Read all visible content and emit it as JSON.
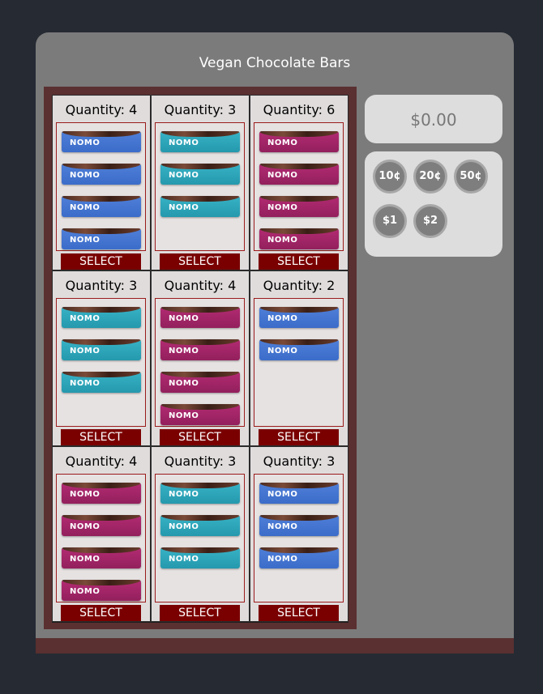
{
  "title": "Vegan Chocolate Bars",
  "display": {
    "amount": "$0.00"
  },
  "coins": [
    "10¢",
    "20¢",
    "50¢",
    "$1",
    "$2"
  ],
  "bar_logo": "NOMO",
  "select_label": "SELECT",
  "quantity_prefix": "Quantity: ",
  "colors": {
    "blue": "#4f7fd8",
    "teal": "#38b2c6",
    "pink": "#b32b73",
    "select": "#7a0000",
    "frame": "#5a3030"
  },
  "slots": [
    {
      "quantity": 4,
      "quantity_label": "Quantity: 4",
      "color": "blue"
    },
    {
      "quantity": 3,
      "quantity_label": "Quantity: 3",
      "color": "teal"
    },
    {
      "quantity": 6,
      "quantity_label": "Quantity: 6",
      "color": "pink"
    },
    {
      "quantity": 3,
      "quantity_label": "Quantity: 3",
      "color": "teal"
    },
    {
      "quantity": 4,
      "quantity_label": "Quantity: 4",
      "color": "pink"
    },
    {
      "quantity": 2,
      "quantity_label": "Quantity: 2",
      "color": "blue"
    },
    {
      "quantity": 4,
      "quantity_label": "Quantity: 4",
      "color": "pink"
    },
    {
      "quantity": 3,
      "quantity_label": "Quantity: 3",
      "color": "teal"
    },
    {
      "quantity": 3,
      "quantity_label": "Quantity: 3",
      "color": "blue"
    }
  ]
}
